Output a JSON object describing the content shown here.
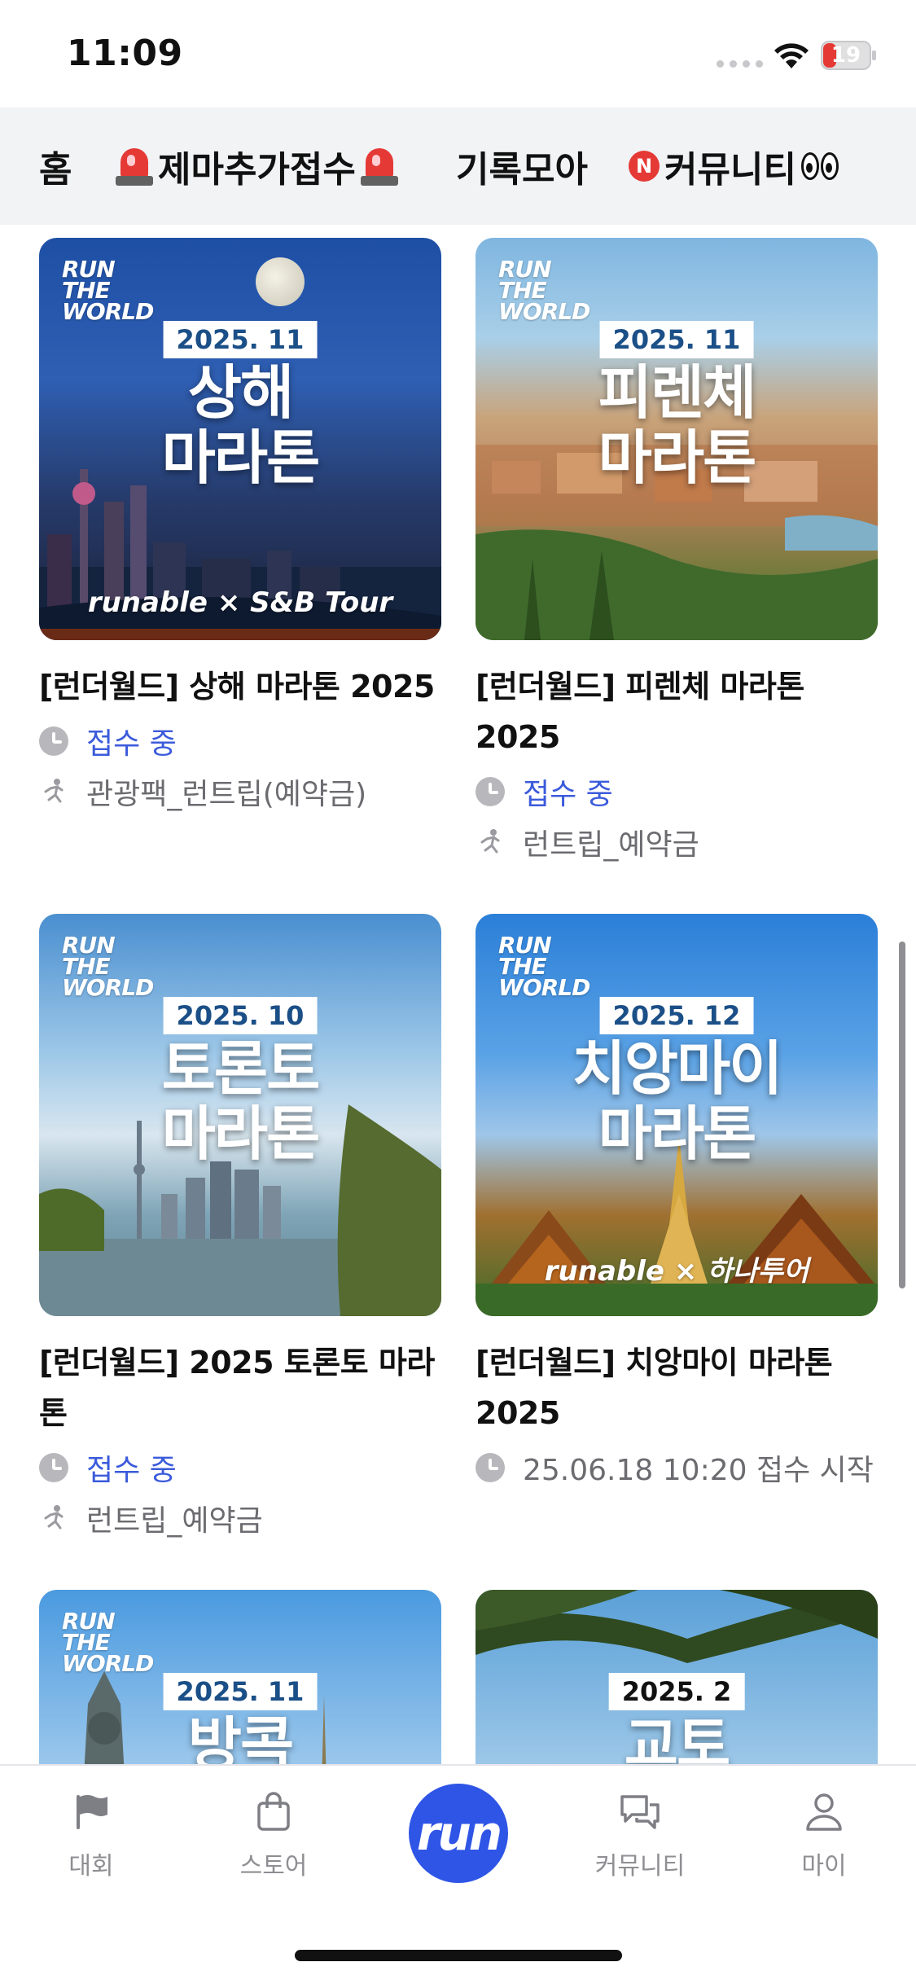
{
  "status_bar": {
    "time": "11:09",
    "battery": "19"
  },
  "tabs": [
    {
      "label": "홈"
    },
    {
      "label": "제마추가접수"
    },
    {
      "label": "기록모아"
    },
    {
      "label": "커뮤니티"
    }
  ],
  "cards": [
    {
      "brand": "RUN THE WORLD",
      "date_tag": "2025. 11",
      "image_title_1": "상해",
      "image_title_2": "마라톤",
      "image_footer": "runable × S&B Tour",
      "title": "[런더월드] 상해 마라톤 2025",
      "status": "접수 중",
      "detail": "관광팩_런트립(예약금)"
    },
    {
      "brand": "RUN THE WORLD",
      "date_tag": "2025. 11",
      "image_title_1": "피렌체",
      "image_title_2": "마라톤",
      "title": "[런더월드] 피렌체 마라톤 2025",
      "status": "접수 중",
      "detail": "런트립_예약금"
    },
    {
      "brand": "RUN THE WORLD",
      "date_tag": "2025. 10",
      "image_title_1": "토론토",
      "image_title_2": "마라톤",
      "title": "[런더월드] 2025 토론토 마라톤",
      "status": "접수 중",
      "detail": "런트립_예약금"
    },
    {
      "brand": "RUN THE WORLD",
      "date_tag": "2025. 12",
      "image_title_1": "치앙마이",
      "image_title_2": "마라톤",
      "image_footer": "runable × 하나투어",
      "title": "[런더월드] 치앙마이 마라톤 2025",
      "status": "25.06.18 10:20 접수 시작"
    },
    {
      "brand": "RUN THE WORLD",
      "date_tag": "2025. 11",
      "image_title_1": "방콕"
    },
    {
      "date_tag": "2025. 2",
      "image_title_1": "교토"
    }
  ],
  "bottom_nav": {
    "items": [
      {
        "label": "대회"
      },
      {
        "label": "스토어"
      },
      {
        "label": "커뮤니티"
      },
      {
        "label": "마이"
      }
    ],
    "center_label": "run"
  },
  "colors": {
    "accent": "#2f55e6",
    "status_open": "#3b5bdb",
    "tab_bg": "#f2f3f5"
  }
}
